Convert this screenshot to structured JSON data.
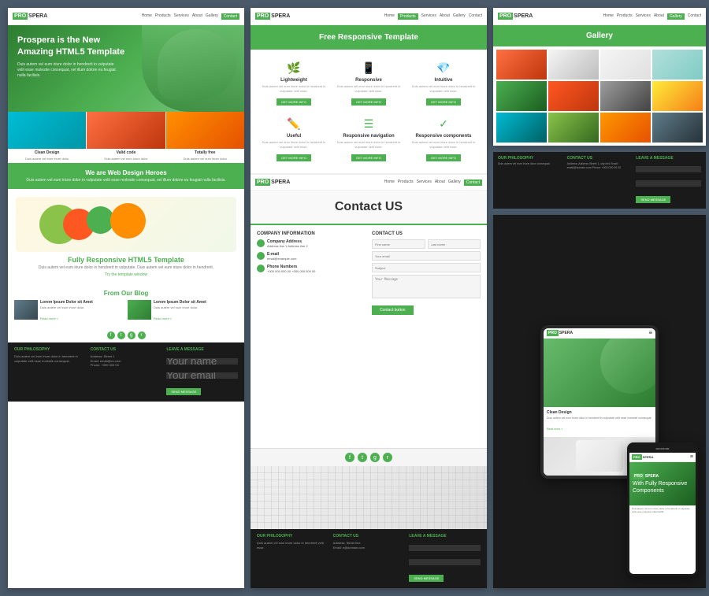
{
  "site": {
    "brand_pro": "PRO",
    "brand_name": "SPERA",
    "tagline": "Prospera is the New Amazing HTML5 Template"
  },
  "col1": {
    "navbar": {
      "links": [
        "Home",
        "Products",
        "Services",
        "About",
        "Gallery",
        "Contact"
      ]
    },
    "hero": {
      "title": "Prospera is the New Amazing HTML5 Template",
      "desc": "Duis autem vel eum iriure dolor in hendrerit in vulputate velit esse molestie consequat, vel illum dolore eu feugiat nulla facilisis."
    },
    "features": [
      {
        "label": "Clean Design",
        "desc": "Duis autem vel eum iriure dolor in hendrerit"
      },
      {
        "label": "Valid code",
        "desc": "Duis autem vel eum iriure dolor in hendrerit"
      },
      {
        "label": "Totally free",
        "desc": "Duis autem vel eum iriure dolor in hendrerit"
      }
    ],
    "green_banner": {
      "title": "We are Web Design Heroes",
      "sub": "Duis autem vel eum iriure dolor in vulputate velit esse molestie consequat, vel illum dolore eu feugiat nulla facilisis."
    },
    "fruit_section": {
      "title": "Fully Responsive",
      "title2": "HTML5 Template",
      "desc": "Duis autem vel eum iriure dolor in hendrerit in vulputate. Duis autem vel eum iriure dolor in hendrerit.",
      "try_link": "Try the template window"
    },
    "blog": {
      "title": "From Our",
      "title2": "Blog",
      "items": [
        {
          "title": "Lorem Ipsum Dolor sit Amet",
          "text": "Duis autem vel eum iriure dolor in hendrerit in vulputate.",
          "read_more": "Read more >"
        },
        {
          "title": "Lorem Ipsum Dolor sit Amet",
          "text": "Duis autem vel eum iriure dolor in hendrerit in vulputate.",
          "read_more": "Read more >"
        }
      ]
    },
    "footer": {
      "col1_title": "OUR PHILOSOPHY",
      "col1_text": "Duis autem vel eum iriure dolor in hendrerit in vulputate velit esse molestie consequat.",
      "col2_title": "CONTACT US",
      "col3_title": "LEAVE A MESSAGE",
      "leave_btn": "SEND MESSAGE"
    }
  },
  "col2_top": {
    "navbar": {
      "links": [
        "Home",
        "Products",
        "Services",
        "About",
        "Gallery",
        "Contact"
      ]
    },
    "header": "Free Responsive Template",
    "features": [
      {
        "icon": "🌿",
        "title": "Lightweight",
        "text": "Duis autem vel eum iriure dolor in hendrerit in vulputate velit esse molestie.",
        "btn": "GET MORE INFO"
      },
      {
        "icon": "📱",
        "title": "Responsive",
        "text": "Duis autem vel eum iriure dolor in hendrerit in vulputate velit esse molestie.",
        "btn": "GET MORE INFO"
      },
      {
        "icon": "💎",
        "title": "Intuitive",
        "text": "Duis autem vel eum iriure dolor in hendrerit in vulputate velit esse molestie.",
        "btn": "GET MORE INFO"
      },
      {
        "icon": "✏️",
        "title": "Useful",
        "text": "Duis autem vel eum iriure dolor in hendrerit in vulputate velit esse molestie.",
        "btn": "GET MORE INFO"
      },
      {
        "icon": "☰",
        "title": "Responsive navigation",
        "text": "Duis autem vel eum iriure dolor in hendrerit in vulputate velit esse molestie.",
        "btn": "GET MORE INFO"
      },
      {
        "icon": "✓",
        "title": "Responsive components",
        "text": "Duis autem vel eum iriure dolor in hendrerit in vulputate velit esse molestie.",
        "btn": "GET MORE INFO"
      }
    ]
  },
  "col2_bottom": {
    "contact_title": "Contact US",
    "company_info_title": "COMPANY INFORMATION",
    "contact_us_title": "CONTACT US",
    "address_label": "Company Address",
    "address_text": "Address line 1\nAddress line 2",
    "email_label": "E-mail",
    "email_text": "email@example.com",
    "phone_label": "Phone Numbers",
    "phone_text": "+000 000 000 00\n+000 000 000 00",
    "form_fields": {
      "first_name": "First name",
      "last_name": "Last name",
      "email": "Your email",
      "subject": "Subject",
      "message": "Your Message",
      "submit": "Contact button"
    },
    "footer": {
      "col1_title": "OUR PHILOSOPHY",
      "col2_title": "CONTACT US",
      "col3_title": "LEAVE A MESSAGE"
    }
  },
  "col3": {
    "gallery_title": "Gallery",
    "navbar_links": [
      "Home",
      "Products",
      "Services",
      "About",
      "Gallery",
      "Contact"
    ],
    "philosophy": {
      "col1_title": "OUR PHILOSOPHY",
      "col1_text": "Duis autem vel eum iriure dolor consequat.",
      "col2_title": "CONTACT US",
      "col2_text": "Address: Address Street 1, city info\nEmail: email@domain.com\nPhone: +000 000 00 00",
      "col3_title": "LEAVE A MESSAGE"
    },
    "tablet": {
      "brand_pro": "PRO",
      "brand_name": "SPERA",
      "hero_text": "Clean Design",
      "content_text": "Duis autem vel eum iriure dolor in hendrerit in vulputate velit esse molestie consequat",
      "read_more": "Read more >"
    },
    "phone": {
      "brand_pro": "PRO",
      "brand_name": "SPERA",
      "hero_text": "With Fully Responsive Components",
      "content_text": "Duis autem vel eum iriure dolor in hendrerit in vulputate velit esse molestie nulla facillis"
    }
  }
}
